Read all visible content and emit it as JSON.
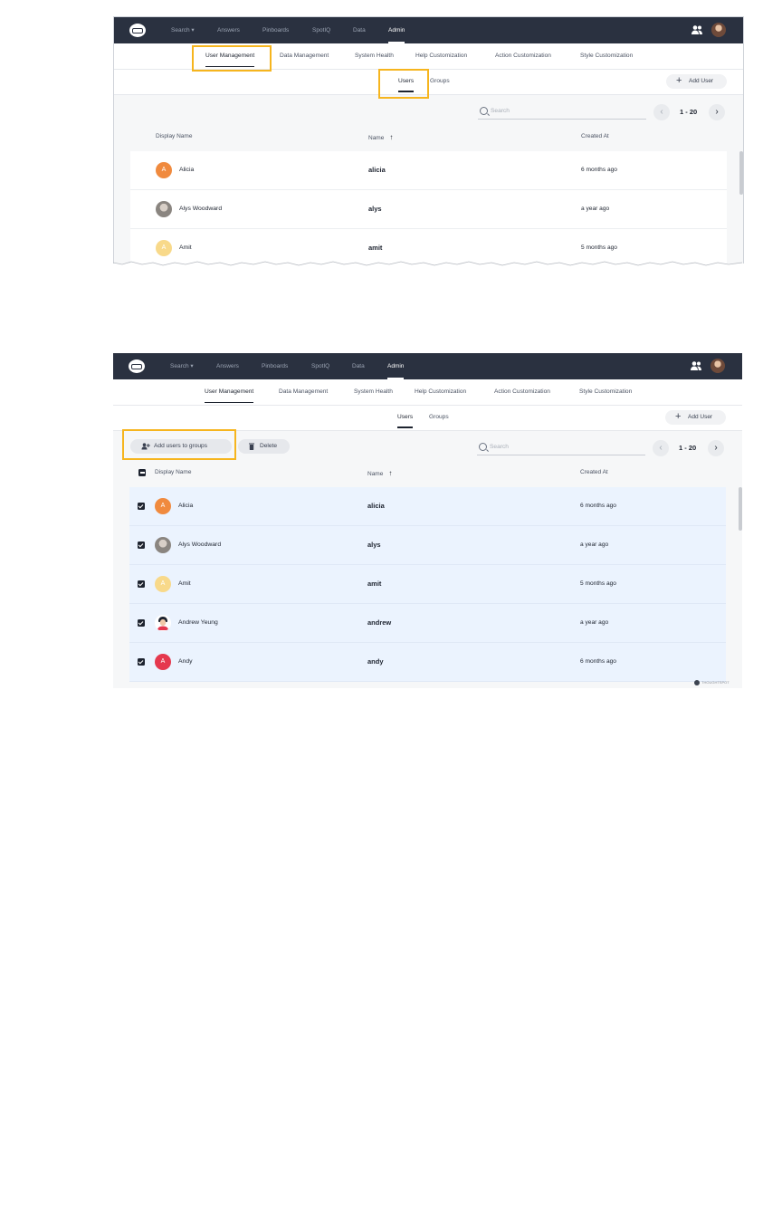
{
  "nav": {
    "items": [
      "Search ▾",
      "Answers",
      "Pinboards",
      "SpotIQ",
      "Data",
      "Admin"
    ],
    "active": "Admin"
  },
  "subnav": {
    "items": [
      "User Management",
      "Data Management",
      "System Health",
      "Help Customization",
      "Action Customization",
      "Style Customization"
    ],
    "active": "User Management"
  },
  "tabs": {
    "users": "Users",
    "groups": "Groups",
    "add_user": "Add User"
  },
  "toolbar": {
    "search_placeholder": "Search",
    "pagination": "1 - 20",
    "add_to_groups": "Add users to groups",
    "delete": "Delete"
  },
  "columns": {
    "display_name": "Display Name",
    "name": "Name",
    "created_at": "Created At"
  },
  "users": [
    {
      "display": "Alicia",
      "name": "alicia",
      "created": "6 months ago",
      "initial": "A",
      "color": "#f08a3e",
      "avatar": "initial"
    },
    {
      "display": "Alys Woodward",
      "name": "alys",
      "created": "a year ago",
      "initial": "",
      "color": "#8a8580",
      "avatar": "photo"
    },
    {
      "display": "Amit",
      "name": "amit",
      "created": "5 months ago",
      "initial": "A",
      "color": "#f8d98a",
      "avatar": "initial"
    },
    {
      "display": "Andrew Yeung",
      "name": "andrew",
      "created": "a year ago",
      "initial": "",
      "color": "#ffffff",
      "avatar": "illustration"
    },
    {
      "display": "Andy",
      "name": "andy",
      "created": "6 months ago",
      "initial": "A",
      "color": "#e5384e",
      "avatar": "initial"
    }
  ],
  "colors": {
    "topnav_bg": "#2a3140",
    "highlight": "#f6b51e",
    "selected_row": "#ebf3fe"
  },
  "footer": {
    "brand": "THOUGHTSPOT"
  }
}
